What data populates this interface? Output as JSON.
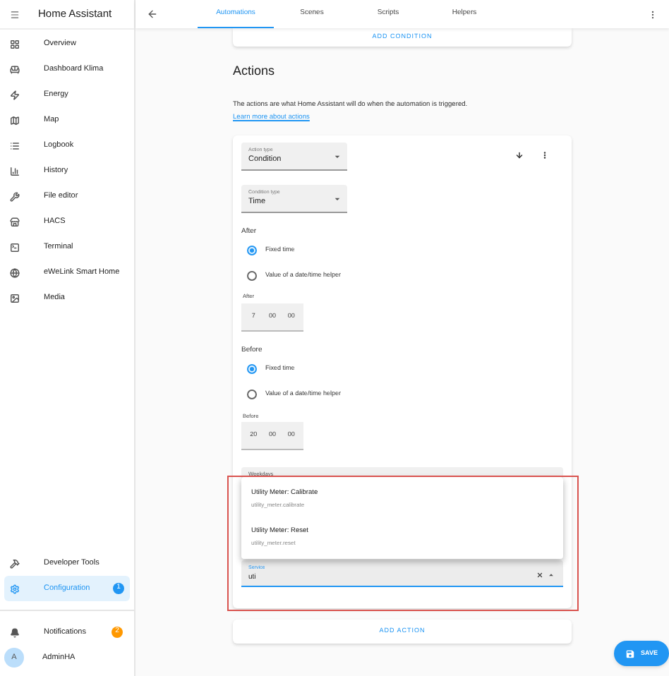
{
  "sidebar": {
    "title": "Home Assistant",
    "items": [
      {
        "label": "Overview",
        "selected": false
      },
      {
        "label": "Dashboard Klima",
        "selected": false
      },
      {
        "label": "Energy",
        "selected": false
      },
      {
        "label": "Map",
        "selected": false
      },
      {
        "label": "Logbook",
        "selected": false
      },
      {
        "label": "History",
        "selected": false
      },
      {
        "label": "File editor",
        "selected": false
      },
      {
        "label": "HACS",
        "selected": false
      },
      {
        "label": "Terminal",
        "selected": false
      },
      {
        "label": "eWeLink Smart Home",
        "selected": false
      },
      {
        "label": "Media",
        "selected": false
      }
    ],
    "bottom_items": [
      {
        "label": "Developer Tools",
        "selected": false
      },
      {
        "label": "Configuration",
        "selected": true,
        "badge": "1",
        "color": "#2196f3"
      }
    ],
    "notifications": {
      "label": "Notifications",
      "badge": "2",
      "color": "#ff9800"
    },
    "user": {
      "initial": "A",
      "name": "AdminHA"
    }
  },
  "tabs": [
    {
      "label": "Automations",
      "selected": true
    },
    {
      "label": "Scenes",
      "selected": false
    },
    {
      "label": "Scripts",
      "selected": false
    },
    {
      "label": "Helpers",
      "selected": false
    }
  ],
  "add_condition": "ADD CONDITION",
  "actions": {
    "heading": "Actions",
    "description": "The actions are what Home Assistant will do when the automation is triggered.",
    "link": "Learn more about actions",
    "action_type": {
      "label": "Action type",
      "value": "Condition"
    },
    "condition_type": {
      "label": "Condition type",
      "value": "Time"
    },
    "times": [
      {
        "heading": "After",
        "options": [
          {
            "label": "Fixed time",
            "selected": true
          },
          {
            "label": "Value of a date/time helper",
            "selected": false
          }
        ],
        "field_label": "After",
        "parts": [
          "7",
          "00",
          "00"
        ]
      },
      {
        "heading": "Before",
        "options": [
          {
            "label": "Fixed time",
            "selected": true
          },
          {
            "label": "Value of a date/time helper",
            "selected": false
          }
        ],
        "field_label": "Before",
        "parts": [
          "20",
          "00",
          "00"
        ]
      }
    ],
    "weekdays_label": "Weekdays",
    "suggestions": [
      {
        "name": "Utility Meter: Calibrate",
        "service": "utility_meter.calibrate"
      },
      {
        "name": "Utility Meter: Reset",
        "service": "utility_meter.reset"
      }
    ],
    "service": {
      "label": "Service",
      "value": "uti"
    }
  },
  "add_action": "ADD ACTION",
  "save": "SAVE"
}
